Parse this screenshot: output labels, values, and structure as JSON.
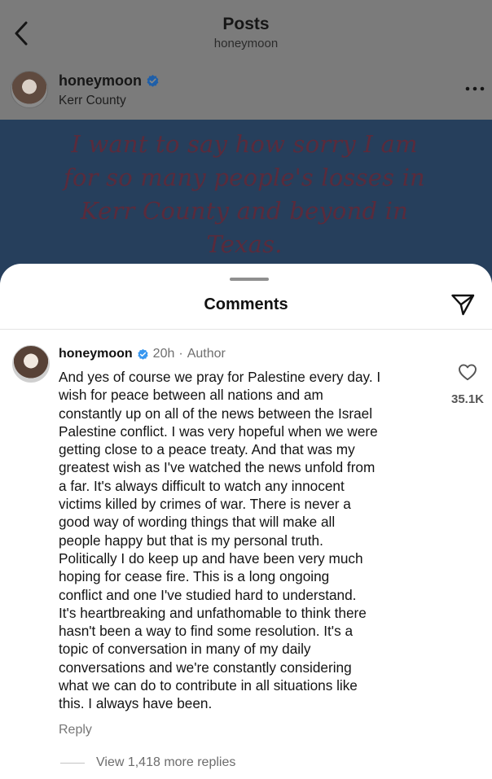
{
  "header": {
    "title": "Posts",
    "subtitle": "honeymoon",
    "back_icon": "chevron-left-icon"
  },
  "post": {
    "username": "honeymoon",
    "verified": true,
    "location": "Kerr County",
    "more_icon": "more-horizontal-icon",
    "image_text": [
      "I want to say how sorry I am",
      "for so many people's losses in",
      "Kerr County and beyond in",
      "Texas."
    ]
  },
  "comments_sheet": {
    "title": "Comments",
    "share_icon": "paper-plane-icon"
  },
  "comment": {
    "username": "honeymoon",
    "verified": true,
    "time": "20h",
    "separator": "·",
    "role": "Author",
    "body_lines": [
      "And yes of course we pray for Palestine every day. I",
      "wish for peace between all nations and am",
      "constantly up on all of the news between the Israel",
      "Palestine conflict. I was very hopeful when we were",
      "getting close to a peace treaty. And that was my",
      "greatest wish as I've watched the news unfold from",
      "a far. It's always difficult to watch any innocent",
      "victims killed by crimes of war. There is never a",
      "good way of wording things that will make all",
      "people happy but that is my personal truth.",
      "Politically I do keep up and have been very much",
      "hoping for cease fire.  This is a long ongoing",
      "conflict and one I've studied hard to understand.",
      "It's heartbreaking and unfathomable to think there",
      "hasn't been a way to find some resolution. It's a",
      "topic of conversation in many of my daily",
      "conversations and we're constantly considering",
      "what we can do to contribute in all situations like",
      "this. I always have been."
    ],
    "like_count": "35.1K",
    "like_icon": "heart-outline-icon",
    "reply_label": "Reply",
    "view_replies_label": "View 1,418 more replies"
  },
  "colors": {
    "verified_blue": "#3897f0",
    "dim_overlay": "#7b7b7b",
    "post_image_bg": "#263f5c"
  }
}
